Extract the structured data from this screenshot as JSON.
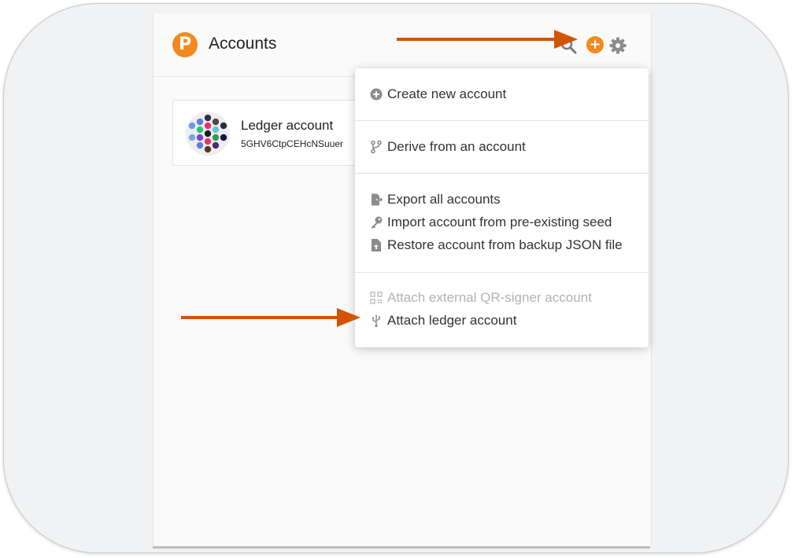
{
  "header": {
    "title": "Accounts",
    "logo_glyph": "P",
    "add_glyph": "+"
  },
  "account": {
    "name": "Ledger account",
    "address": "5GHV6CtpCEHcNSuuer"
  },
  "menu": {
    "create": "Create new account",
    "derive": "Derive from an account",
    "export_all": "Export all accounts",
    "import_seed": "Import account from pre-existing seed",
    "restore_json": "Restore account from backup JSON file",
    "attach_qr": "Attach external QR-signer account",
    "attach_ledger": "Attach ledger account"
  },
  "icons": {
    "logo": "polkadot-logo-icon",
    "search": "search-icon",
    "add": "plus-circle-icon",
    "settings": "gear-icon",
    "create": "plus-circle-icon",
    "derive": "code-branch-icon",
    "export": "file-export-icon",
    "import": "key-icon",
    "restore": "file-upload-icon",
    "qr": "qrcode-icon",
    "usb": "usb-icon"
  },
  "colors": {
    "accent": "#f3891f",
    "annotation_arrow": "#d35400",
    "disabled_text": "#b3b3b3",
    "background": "#fafafa"
  }
}
